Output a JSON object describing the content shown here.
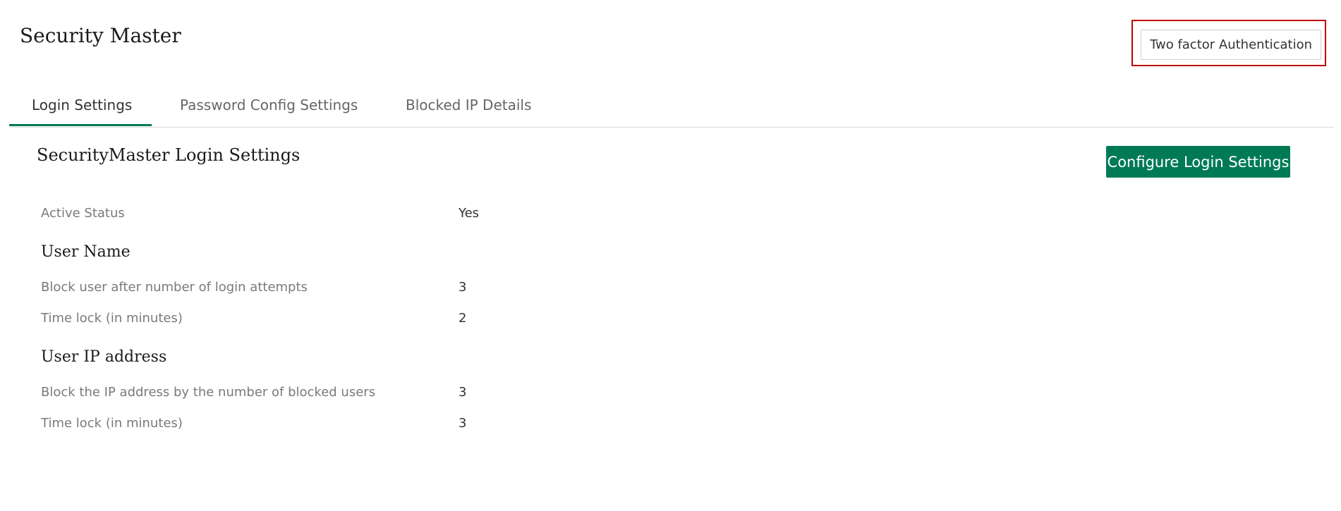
{
  "header": {
    "title": "Security Master",
    "two_factor_button": "Two factor Authentication"
  },
  "tabs": [
    {
      "label": "Login Settings",
      "active": true
    },
    {
      "label": "Password Config Settings",
      "active": false
    },
    {
      "label": "Blocked IP Details",
      "active": false
    }
  ],
  "section": {
    "title": "SecurityMaster Login Settings",
    "configure_button": "Configure Login Settings"
  },
  "settings": {
    "active_status": {
      "label": "Active Status",
      "value": "Yes"
    },
    "user_name": {
      "heading": "User Name",
      "rows": [
        {
          "label": "Block user after number of login attempts",
          "value": "3"
        },
        {
          "label": "Time lock (in minutes)",
          "value": "2"
        }
      ]
    },
    "user_ip": {
      "heading": "User IP address",
      "rows": [
        {
          "label": "Block the IP address by the number of blocked users",
          "value": "3"
        },
        {
          "label": "Time lock (in minutes)",
          "value": "3"
        }
      ]
    }
  },
  "colors": {
    "accent": "#007a55",
    "highlight": "#c00000"
  }
}
